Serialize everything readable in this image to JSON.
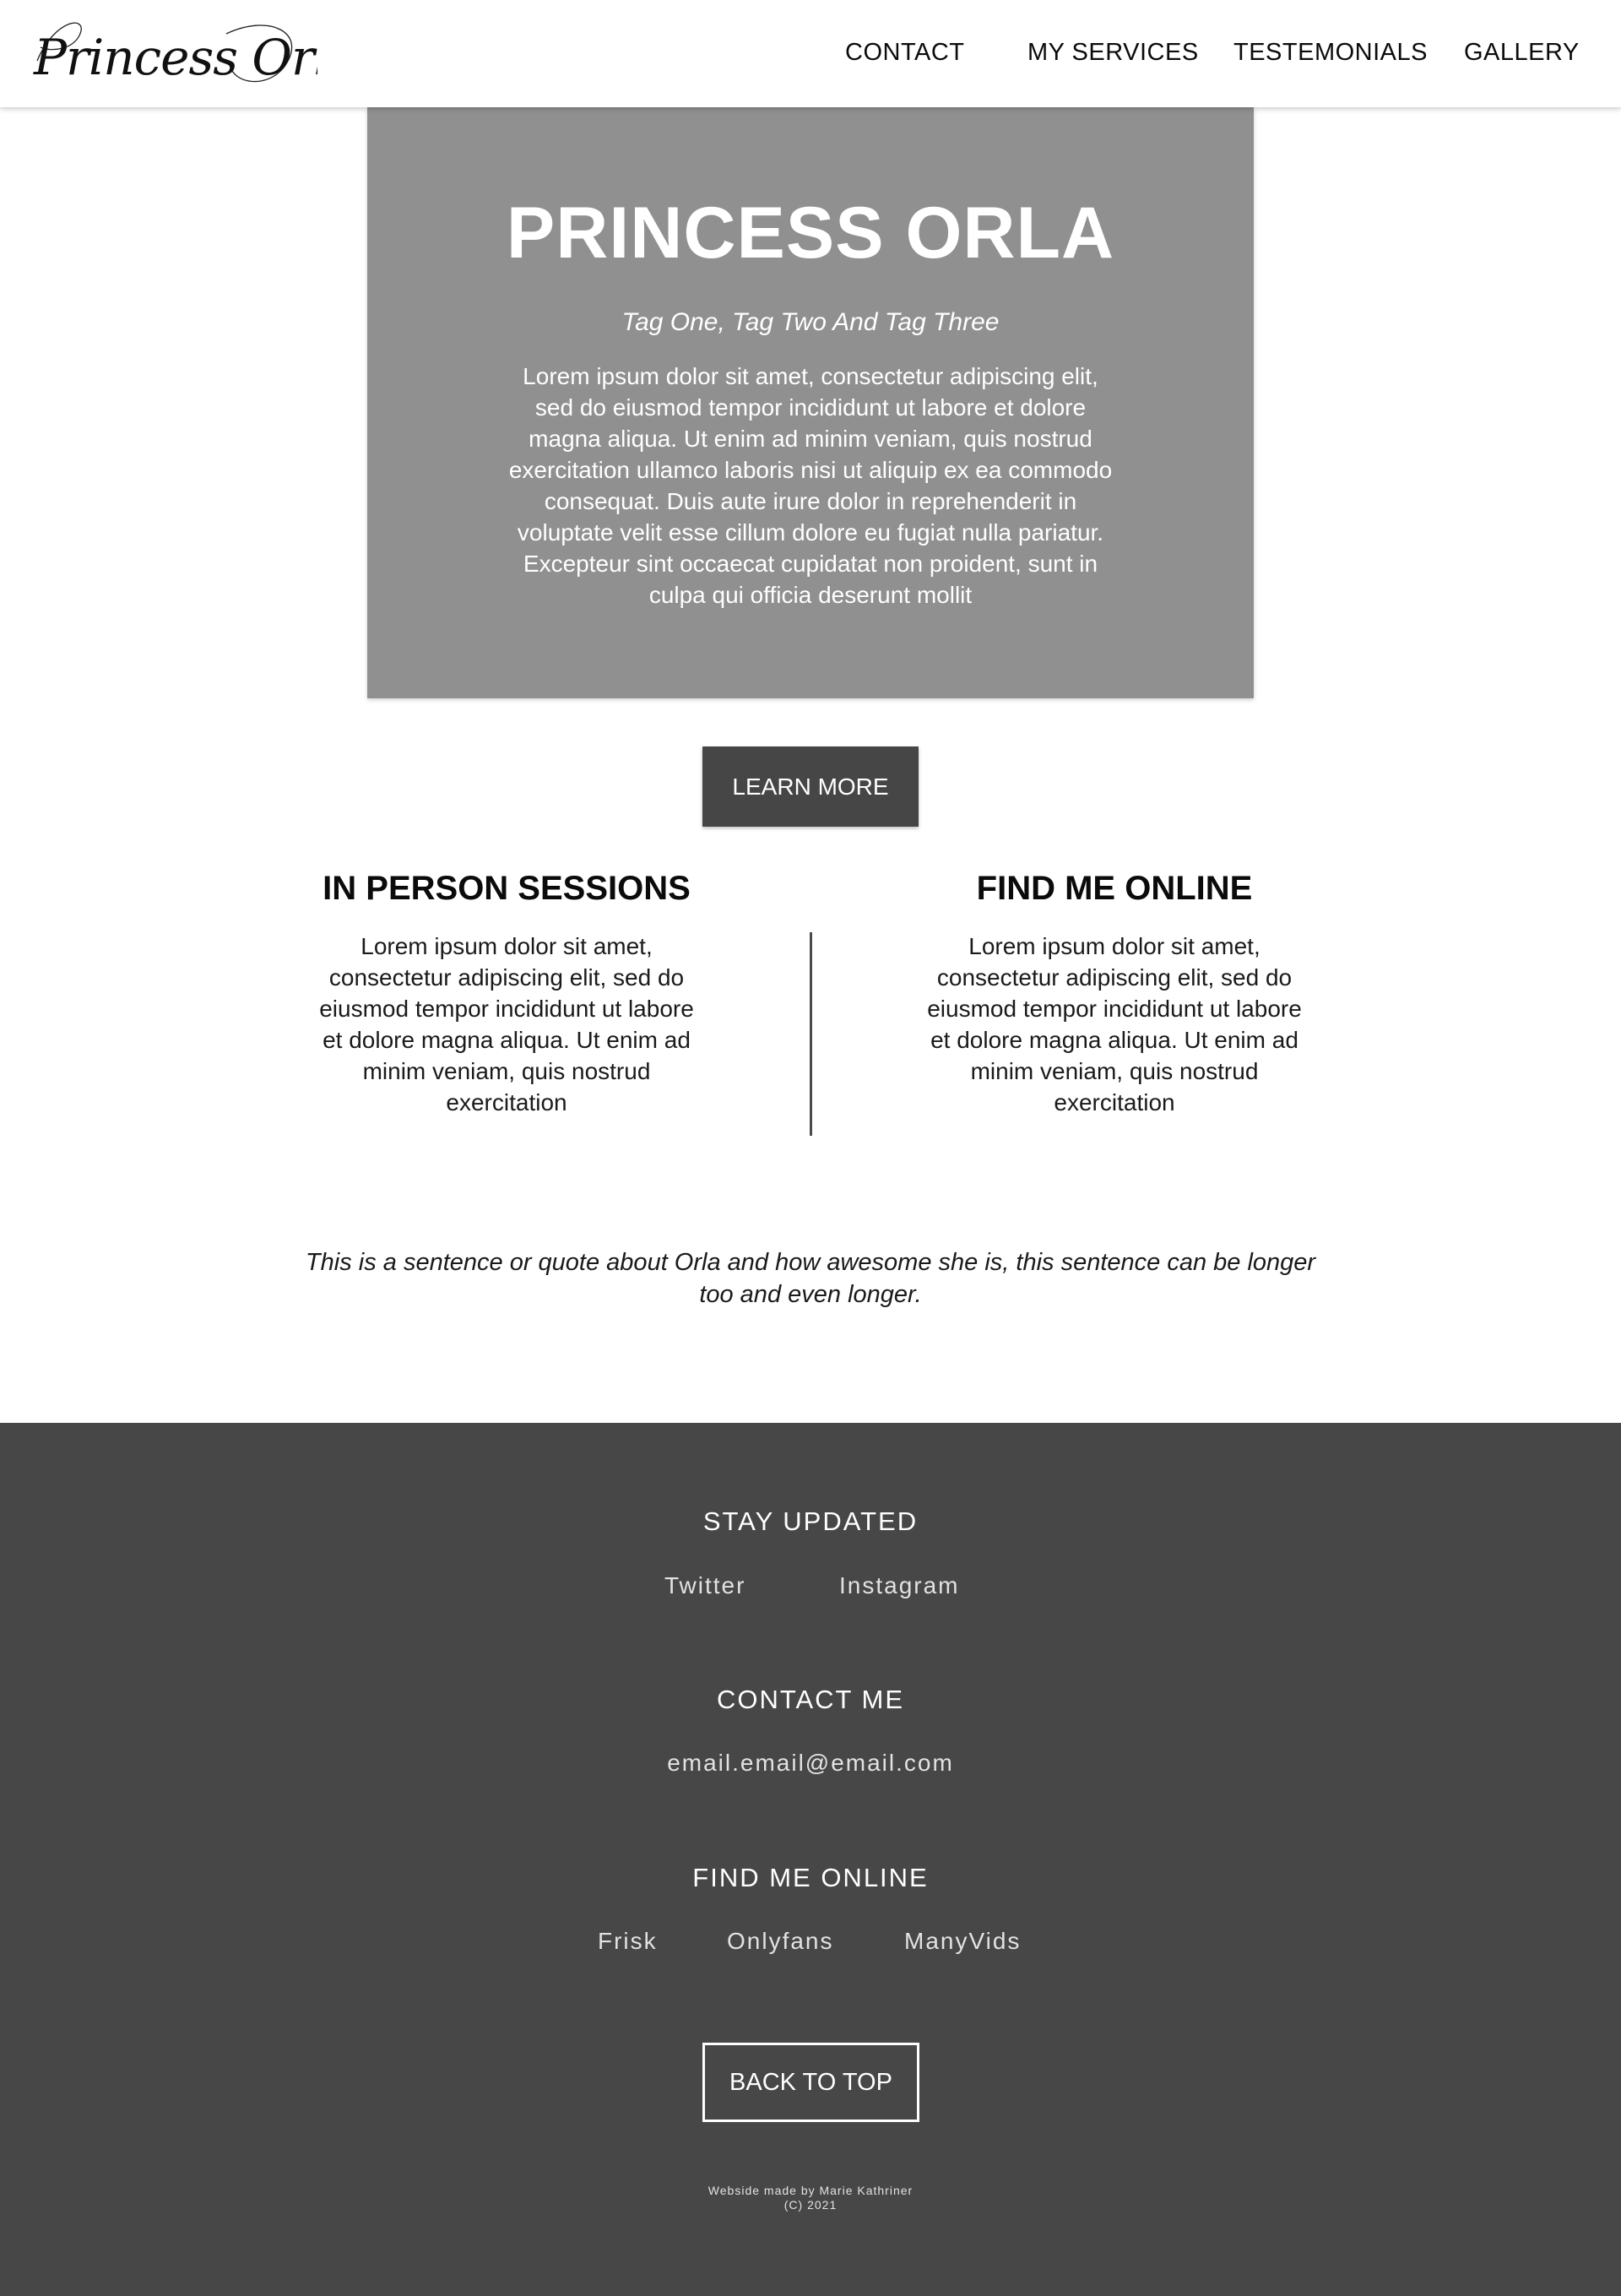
{
  "header": {
    "logo_text": "Princess Orla",
    "nav": {
      "contact": "CONTACT",
      "services": "MY SERVICES",
      "testimonials": "TESTEMONIALS",
      "gallery": "GALLERY"
    }
  },
  "hero": {
    "title": "PRINCESS ORLA",
    "tags": "Tag One, Tag Two And Tag Three",
    "body": "Lorem ipsum dolor sit amet, consectetur adipiscing elit, sed do eiusmod tempor incididunt ut labore et dolore magna aliqua. Ut enim ad minim veniam, quis nostrud exercitation ullamco laboris nisi ut aliquip ex ea commodo consequat. Duis aute irure dolor in reprehenderit in voluptate velit esse cillum dolore eu fugiat nulla pariatur. Excepteur sint occaecat cupidatat non proident, sunt in culpa qui officia deserunt mollit",
    "learn_more": "LEARN MORE"
  },
  "columns": {
    "left": {
      "title": "IN PERSON SESSIONS",
      "body": "Lorem ipsum dolor sit amet, consectetur adipiscing elit, sed do eiusmod tempor incididunt ut labore et dolore magna aliqua. Ut enim ad minim veniam, quis nostrud exercitation"
    },
    "right": {
      "title": "FIND ME ONLINE",
      "body": "Lorem ipsum dolor sit amet, consectetur adipiscing elit, sed do eiusmod tempor incididunt ut labore et dolore magna aliqua. Ut enim ad minim veniam, quis nostrud exercitation"
    }
  },
  "quote": "This is a sentence or quote about Orla and how awesome she is, this sentence can be longer too and even longer.",
  "footer": {
    "stay_updated": {
      "heading": "STAY UPDATED",
      "twitter": "Twitter",
      "instagram": "Instagram"
    },
    "contact": {
      "heading": "CONTACT ME",
      "email": "email.email@email.com"
    },
    "online": {
      "heading": "FIND ME ONLINE",
      "frisk": "Frisk",
      "onlyfans": "Onlyfans",
      "manyvids": "ManyVids"
    },
    "back_to_top": "BACK TO TOP",
    "credit_line1": "Webside made by Marie Kathriner",
    "credit_line2": "(C) 2021"
  },
  "colors": {
    "hero_bg": "#909090",
    "button_bg": "#464646",
    "footer_bg": "#474747",
    "text_dark": "#0b0b0b",
    "text_light": "#ffffff"
  }
}
